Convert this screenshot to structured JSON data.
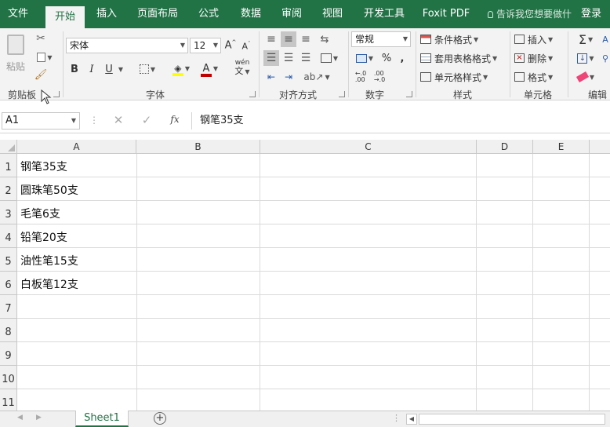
{
  "tabs": [
    {
      "label": "文件"
    },
    {
      "label": "开始"
    },
    {
      "label": "插入"
    },
    {
      "label": "页面布局"
    },
    {
      "label": "公式"
    },
    {
      "label": "数据"
    },
    {
      "label": "审阅"
    },
    {
      "label": "视图"
    },
    {
      "label": "开发工具"
    },
    {
      "label": "Foxit PDF"
    }
  ],
  "tellme": "告诉我您想要做什",
  "login": "登录",
  "ribbon": {
    "clipboard": {
      "label": "剪贴板",
      "paste": "粘贴"
    },
    "font": {
      "label": "字体",
      "name": "宋体",
      "size": "12",
      "bold": "B",
      "italic": "I",
      "underline": "U",
      "phonetic": "wén"
    },
    "alignment": {
      "label": "对齐方式"
    },
    "number": {
      "label": "数字",
      "format": "常规",
      "percent": "%",
      "comma": ","
    },
    "styles": {
      "label": "样式",
      "conditional": "条件格式",
      "table": "套用表格格式",
      "cell": "单元格样式"
    },
    "cells": {
      "label": "单元格",
      "insert": "插入",
      "delete": "删除",
      "format": "格式"
    },
    "editing": {
      "label": "编辑"
    }
  },
  "namebox": "A1",
  "formula": "钢笔35支",
  "fx": "fx",
  "columns": [
    "A",
    "B",
    "C",
    "D",
    "E"
  ],
  "rows": [
    "1",
    "2",
    "3",
    "4",
    "5",
    "6",
    "7",
    "8",
    "9",
    "10",
    "11"
  ],
  "cells": [
    "钢笔35支",
    "圆珠笔50支",
    "毛笔6支",
    "铅笔20支",
    "油性笔15支",
    "白板笔12支"
  ],
  "sheet": "Sheet1",
  "colors": {
    "brand": "#217346",
    "font_color": "#c00000",
    "fill_color": "#ffff00"
  }
}
